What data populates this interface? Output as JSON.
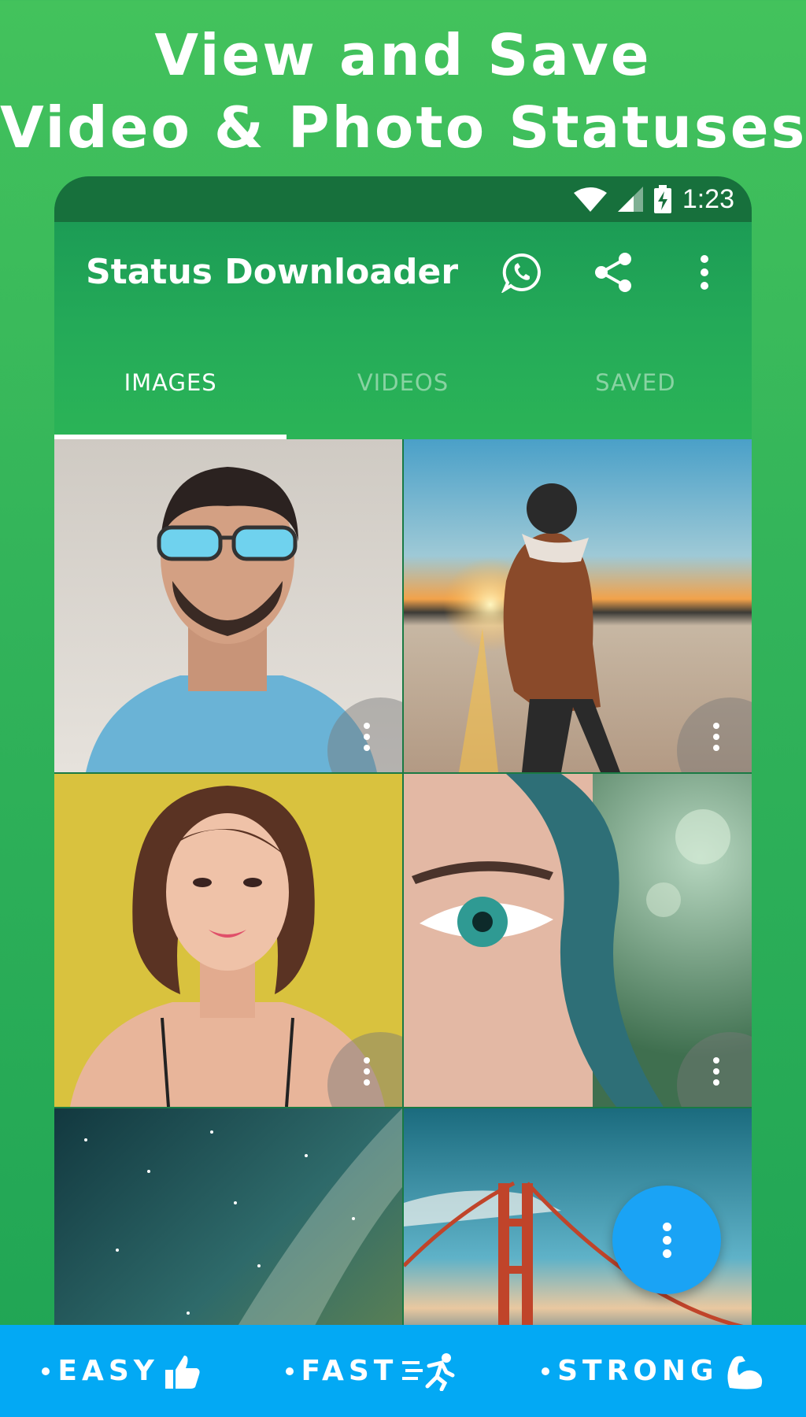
{
  "headline": {
    "line1": "View and Save",
    "line2": "Video & Photo Statuses"
  },
  "statusbar": {
    "time": "1:23"
  },
  "appbar": {
    "title": "Status Downloader"
  },
  "tabs": [
    {
      "label": "IMAGES",
      "active": true
    },
    {
      "label": "VIDEOS",
      "active": false
    },
    {
      "label": "SAVED",
      "active": false
    }
  ],
  "tiles": [
    {
      "subject": "man with sunglasses"
    },
    {
      "subject": "person at sunset"
    },
    {
      "subject": "woman portrait"
    },
    {
      "subject": "eye close-up"
    },
    {
      "subject": "starry night sky"
    },
    {
      "subject": "golden gate bridge"
    }
  ],
  "features": [
    {
      "label": "EASY",
      "icon": "thumbs-up-icon"
    },
    {
      "label": "FAST",
      "icon": "running-icon"
    },
    {
      "label": "STRONG",
      "icon": "muscle-icon"
    }
  ],
  "colors": {
    "primary": "#23a858",
    "accent": "#1aa3f5",
    "banner": "#03a9f4"
  }
}
